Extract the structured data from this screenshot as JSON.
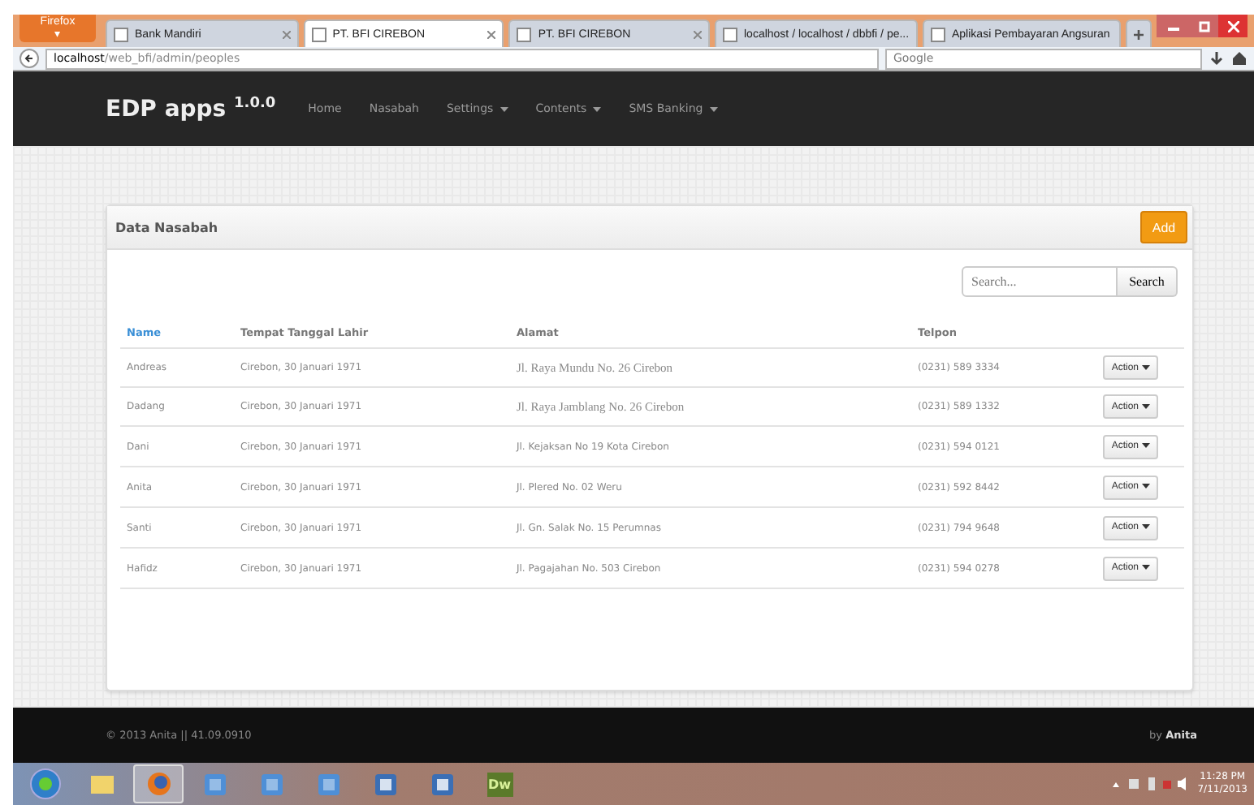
{
  "browser": {
    "menu_button": "Firefox ▾",
    "tabs": [
      {
        "title": "Bank Mandiri",
        "selected": false
      },
      {
        "title": "PT. BFI CIREBON",
        "selected": true
      },
      {
        "title": "PT. BFI CIREBON",
        "selected": false
      },
      {
        "title": "localhost / localhost / dbbfi / pe...",
        "selected": false
      },
      {
        "title": "Aplikasi Pembayaran Angsuran",
        "selected": false
      }
    ],
    "address": {
      "host": "localhost",
      "path": "/web_bfi/admin/peoples"
    },
    "search_placeholder": "Google"
  },
  "navbar": {
    "brand": "EDP apps",
    "version": "1.0.0",
    "items": [
      {
        "label": "Home",
        "dropdown": false
      },
      {
        "label": "Nasabah",
        "dropdown": false
      },
      {
        "label": "Settings",
        "dropdown": true
      },
      {
        "label": "Contents",
        "dropdown": true
      },
      {
        "label": "SMS Banking",
        "dropdown": true
      }
    ]
  },
  "panel": {
    "title": "Data Nasabah",
    "add_button": "Add",
    "search_placeholder": "Search...",
    "search_button": "Search",
    "columns": [
      {
        "label": "Name",
        "sorted": true
      },
      {
        "label": "Tempat Tanggal Lahir",
        "sorted": false
      },
      {
        "label": "Alamat",
        "sorted": false
      },
      {
        "label": "Telpon",
        "sorted": false
      }
    ],
    "rows": [
      {
        "name": "Andreas",
        "birth": "Cirebon, 30 Januari 1971",
        "address": "Jl. Raya Mundu No. 26 Cirebon",
        "serif": true,
        "phone": "(0231) 589 3334",
        "action": "Action"
      },
      {
        "name": "Dadang",
        "birth": "Cirebon, 30 Januari 1971",
        "address": "Jl. Raya Jamblang No. 26 Cirebon",
        "serif": true,
        "phone": "(0231) 589 1332",
        "action": "Action"
      },
      {
        "name": "Dani",
        "birth": "Cirebon, 30 Januari 1971",
        "address": "Jl. Kejaksan No 19 Kota Cirebon",
        "serif": false,
        "phone": "(0231) 594 0121",
        "action": "Action"
      },
      {
        "name": "Anita",
        "birth": "Cirebon, 30 Januari 1971",
        "address": "Jl. Plered No. 02 Weru",
        "serif": false,
        "phone": "(0231) 592 8442",
        "action": "Action"
      },
      {
        "name": "Santi",
        "birth": "Cirebon, 30 Januari 1971",
        "address": "Jl. Gn. Salak No. 15 Perumnas",
        "serif": false,
        "phone": "(0231) 794 9648",
        "action": "Action"
      },
      {
        "name": "Hafidz",
        "birth": "Cirebon, 30 Januari 1971",
        "address": "Jl. Pagajahan No. 503 Cirebon",
        "serif": false,
        "phone": "(0231) 594 0278",
        "action": "Action"
      }
    ]
  },
  "footer": {
    "copyright": "© 2013 Anita || 41.09.0910",
    "by": "by",
    "author": "Anita"
  },
  "taskbar": {
    "apps": [
      {
        "kind": "start"
      },
      {
        "kind": "folder"
      },
      {
        "kind": "firefox",
        "selected": true
      },
      {
        "kind": "tool"
      },
      {
        "kind": "tool"
      },
      {
        "kind": "tool"
      },
      {
        "kind": "doc"
      },
      {
        "kind": "doc"
      },
      {
        "kind": "text",
        "label": "Dw"
      }
    ],
    "time": "11:28 PM",
    "date": "7/11/2013"
  }
}
